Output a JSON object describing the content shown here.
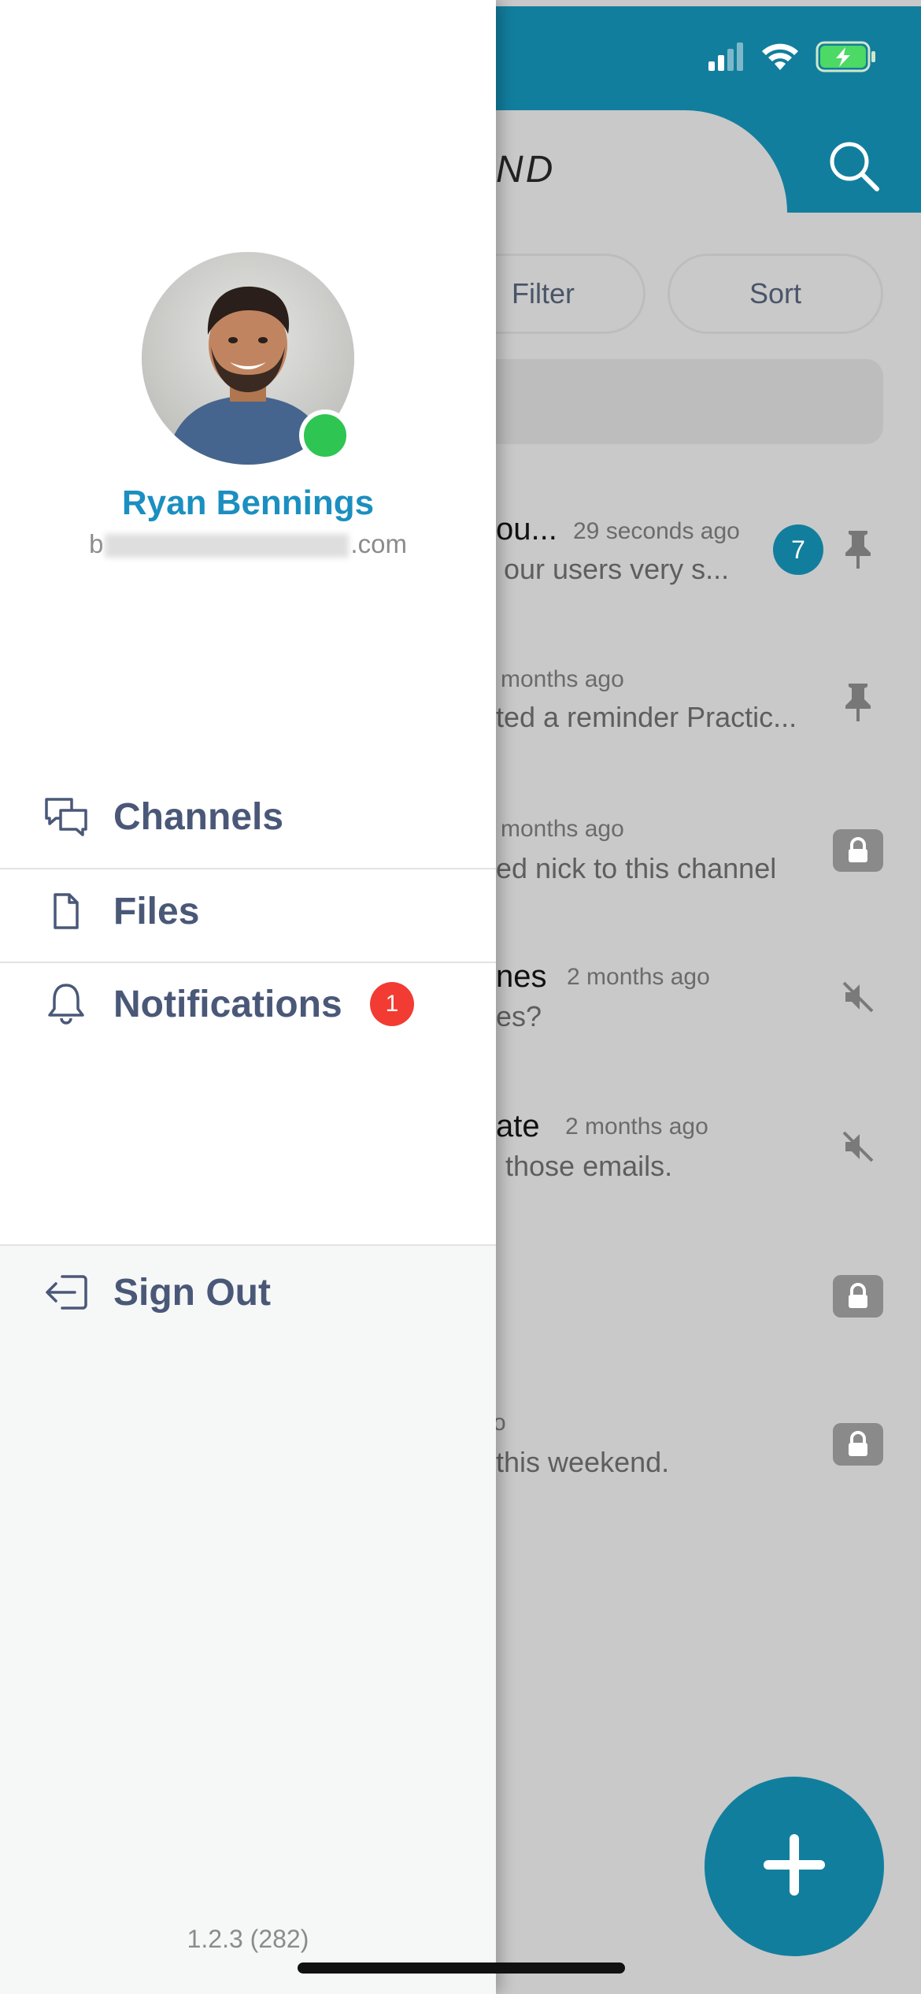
{
  "status_bar": {
    "signal_icon": "cellular-signal-icon",
    "wifi_icon": "wifi-icon",
    "battery_icon": "battery-charging-icon"
  },
  "background_app": {
    "header_title": "SEND",
    "search_icon": "search-icon",
    "filter_label": "Filter",
    "sort_label": "Sort",
    "channels": [
      {
        "title": "ou...",
        "time": "29 seconds ago",
        "subtitle": "our users very s...",
        "count": "7",
        "right_icon": "pin-icon"
      },
      {
        "title": "",
        "time": "months ago",
        "subtitle": "ted a reminder Practic...",
        "right_icon": "pin-icon"
      },
      {
        "title": "",
        "time": "months ago",
        "subtitle": "ed nick to this channel",
        "right_icon": "lock-icon"
      },
      {
        "title": "nes",
        "time": "2 months ago",
        "subtitle": "es?",
        "right_icon": "muted-icon"
      },
      {
        "title": "ate",
        "time": "2 months ago",
        "subtitle": "those emails.",
        "right_icon": "muted-icon"
      },
      {
        "title": "",
        "time": "",
        "subtitle": "",
        "right_icon": "lock-icon"
      },
      {
        "title": "",
        "time": "o",
        "subtitle": "this weekend.",
        "right_icon": "lock-icon"
      }
    ],
    "fab_icon": "plus-icon"
  },
  "drawer": {
    "user": {
      "name": "Ryan Bennings",
      "email_prefix": "b",
      "email_suffix": ".com",
      "status": "online"
    },
    "menu": [
      {
        "label": "Channels",
        "icon": "chat-bubbles-icon"
      },
      {
        "label": "Files",
        "icon": "file-icon"
      },
      {
        "label": "Notifications",
        "icon": "bell-icon",
        "badge": "1"
      }
    ],
    "sign_out": {
      "label": "Sign Out",
      "icon": "sign-out-icon"
    },
    "version": "1.2.3 (282)"
  },
  "colors": {
    "brand": "#127e9e",
    "name": "#1b8fc0",
    "menu_text": "#4a5878",
    "online": "#2ec552",
    "badge": "#f23b32"
  }
}
